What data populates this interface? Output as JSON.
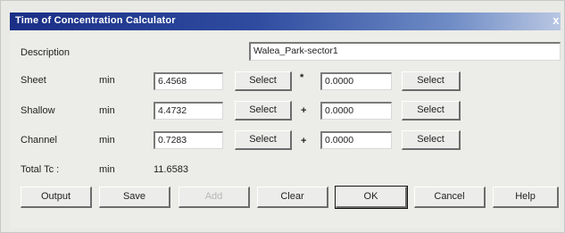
{
  "window": {
    "title": "Time of Concentration Calculator",
    "close_glyph": "x"
  },
  "description": {
    "label": "Description",
    "value": "Walea_Park-sector1"
  },
  "rows": [
    {
      "label": "Sheet",
      "unit": "min",
      "value": "6.4568",
      "select_label": "Select",
      "operator": "*",
      "factor": "0.0000",
      "select2_label": "Select"
    },
    {
      "label": "Shallow",
      "unit": "min",
      "value": "4.4732",
      "select_label": "Select",
      "operator": "+",
      "factor": "0.0000",
      "select2_label": "Select"
    },
    {
      "label": "Channel",
      "unit": "min",
      "value": "0.7283",
      "select_label": "Select",
      "operator": "+",
      "factor": "0.0000",
      "select2_label": "Select"
    }
  ],
  "total": {
    "label": "Total Tc :",
    "unit": "min",
    "value": "11.6583"
  },
  "buttons": {
    "output": "Output",
    "save": "Save",
    "add": "Add",
    "clear": "Clear",
    "ok": "OK",
    "cancel": "Cancel",
    "help": "Help"
  }
}
